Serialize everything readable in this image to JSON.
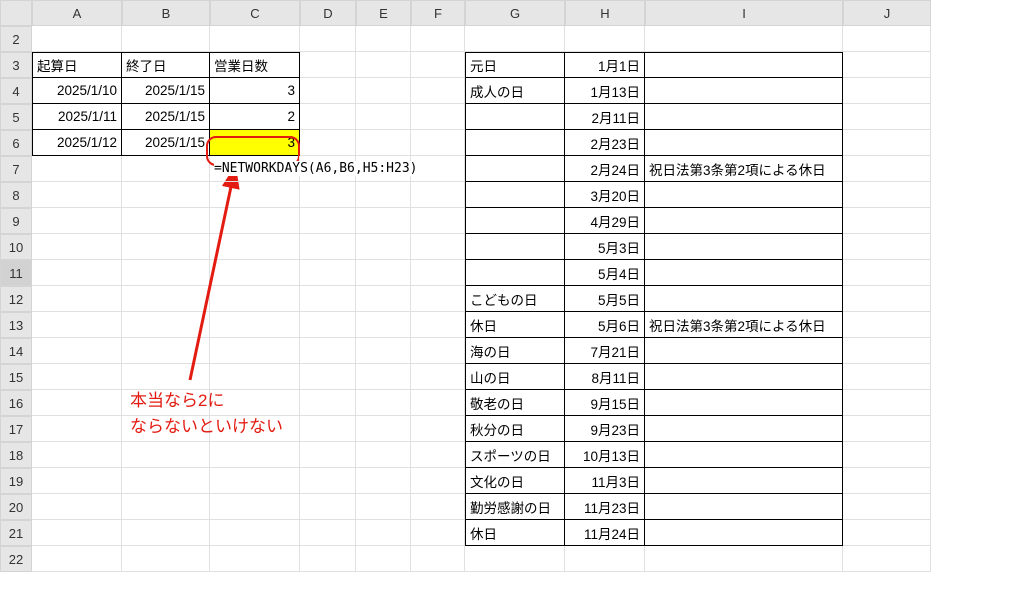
{
  "columns": [
    "A",
    "B",
    "C",
    "D",
    "E",
    "F",
    "G",
    "H",
    "I",
    "J"
  ],
  "rows": [
    "2",
    "3",
    "4",
    "5",
    "6",
    "7",
    "8",
    "9",
    "10",
    "11",
    "12",
    "13",
    "14",
    "15",
    "16",
    "17",
    "18",
    "19",
    "20",
    "21",
    "22"
  ],
  "left_table": {
    "headers": {
      "a": "起算日",
      "b": "終了日",
      "c": "営業日数"
    },
    "data": [
      {
        "a": "2025/1/10",
        "b": "2025/1/15",
        "c": "3"
      },
      {
        "a": "2025/1/11",
        "b": "2025/1/15",
        "c": "2"
      },
      {
        "a": "2025/1/12",
        "b": "2025/1/15",
        "c": "3"
      }
    ]
  },
  "formula": "=NETWORKDAYS(A6,B6,H5:H23)",
  "right_table": [
    {
      "g": "元日",
      "h": "1月1日",
      "i": ""
    },
    {
      "g": "成人の日",
      "h": "1月13日",
      "i": ""
    },
    {
      "g": "",
      "h": "2月11日",
      "i": ""
    },
    {
      "g": "",
      "h": "2月23日",
      "i": ""
    },
    {
      "g": "",
      "h": "2月24日",
      "i": "祝日法第3条第2項による休日"
    },
    {
      "g": "",
      "h": "3月20日",
      "i": ""
    },
    {
      "g": "",
      "h": "4月29日",
      "i": ""
    },
    {
      "g": "",
      "h": "5月3日",
      "i": ""
    },
    {
      "g": "",
      "h": "5月4日",
      "i": ""
    },
    {
      "g": "こどもの日",
      "h": "5月5日",
      "i": ""
    },
    {
      "g": "休日",
      "h": "5月6日",
      "i": "祝日法第3条第2項による休日"
    },
    {
      "g": "海の日",
      "h": "7月21日",
      "i": ""
    },
    {
      "g": "山の日",
      "h": "8月11日",
      "i": ""
    },
    {
      "g": "敬老の日",
      "h": "9月15日",
      "i": ""
    },
    {
      "g": "秋分の日",
      "h": "9月23日",
      "i": ""
    },
    {
      "g": "スポーツの日",
      "h": "10月13日",
      "i": ""
    },
    {
      "g": "文化の日",
      "h": "11月3日",
      "i": ""
    },
    {
      "g": "勤労感謝の日",
      "h": "11月23日",
      "i": ""
    },
    {
      "g": "休日",
      "h": "11月24日",
      "i": ""
    }
  ],
  "annotation": {
    "line1": "本当なら2に",
    "line2": "ならないといけない"
  },
  "chart_data": {
    "type": "table",
    "left": {
      "columns": [
        "起算日",
        "終了日",
        "営業日数"
      ],
      "rows": [
        [
          "2025/1/10",
          "2025/1/15",
          3
        ],
        [
          "2025/1/11",
          "2025/1/15",
          2
        ],
        [
          "2025/1/12",
          "2025/1/15",
          3
        ]
      ]
    },
    "formula_cell": "C6",
    "formula": "=NETWORKDAYS(A6,B6,H5:H23)",
    "holidays_2025": [
      {
        "name": "元日",
        "date": "1月1日"
      },
      {
        "name": "成人の日",
        "date": "1月13日"
      },
      {
        "name": "",
        "date": "2月11日"
      },
      {
        "name": "",
        "date": "2月23日"
      },
      {
        "name": "",
        "date": "2月24日",
        "note": "祝日法第3条第2項による休日"
      },
      {
        "name": "",
        "date": "3月20日"
      },
      {
        "name": "",
        "date": "4月29日"
      },
      {
        "name": "",
        "date": "5月3日"
      },
      {
        "name": "",
        "date": "5月4日"
      },
      {
        "name": "こどもの日",
        "date": "5月5日"
      },
      {
        "name": "休日",
        "date": "5月6日",
        "note": "祝日法第3条第2項による休日"
      },
      {
        "name": "海の日",
        "date": "7月21日"
      },
      {
        "name": "山の日",
        "date": "8月11日"
      },
      {
        "name": "敬老の日",
        "date": "9月15日"
      },
      {
        "name": "秋分の日",
        "date": "9月23日"
      },
      {
        "name": "スポーツの日",
        "date": "10月13日"
      },
      {
        "name": "文化の日",
        "date": "11月3日"
      },
      {
        "name": "勤労感謝の日",
        "date": "11月23日"
      },
      {
        "name": "休日",
        "date": "11月24日"
      }
    ]
  }
}
